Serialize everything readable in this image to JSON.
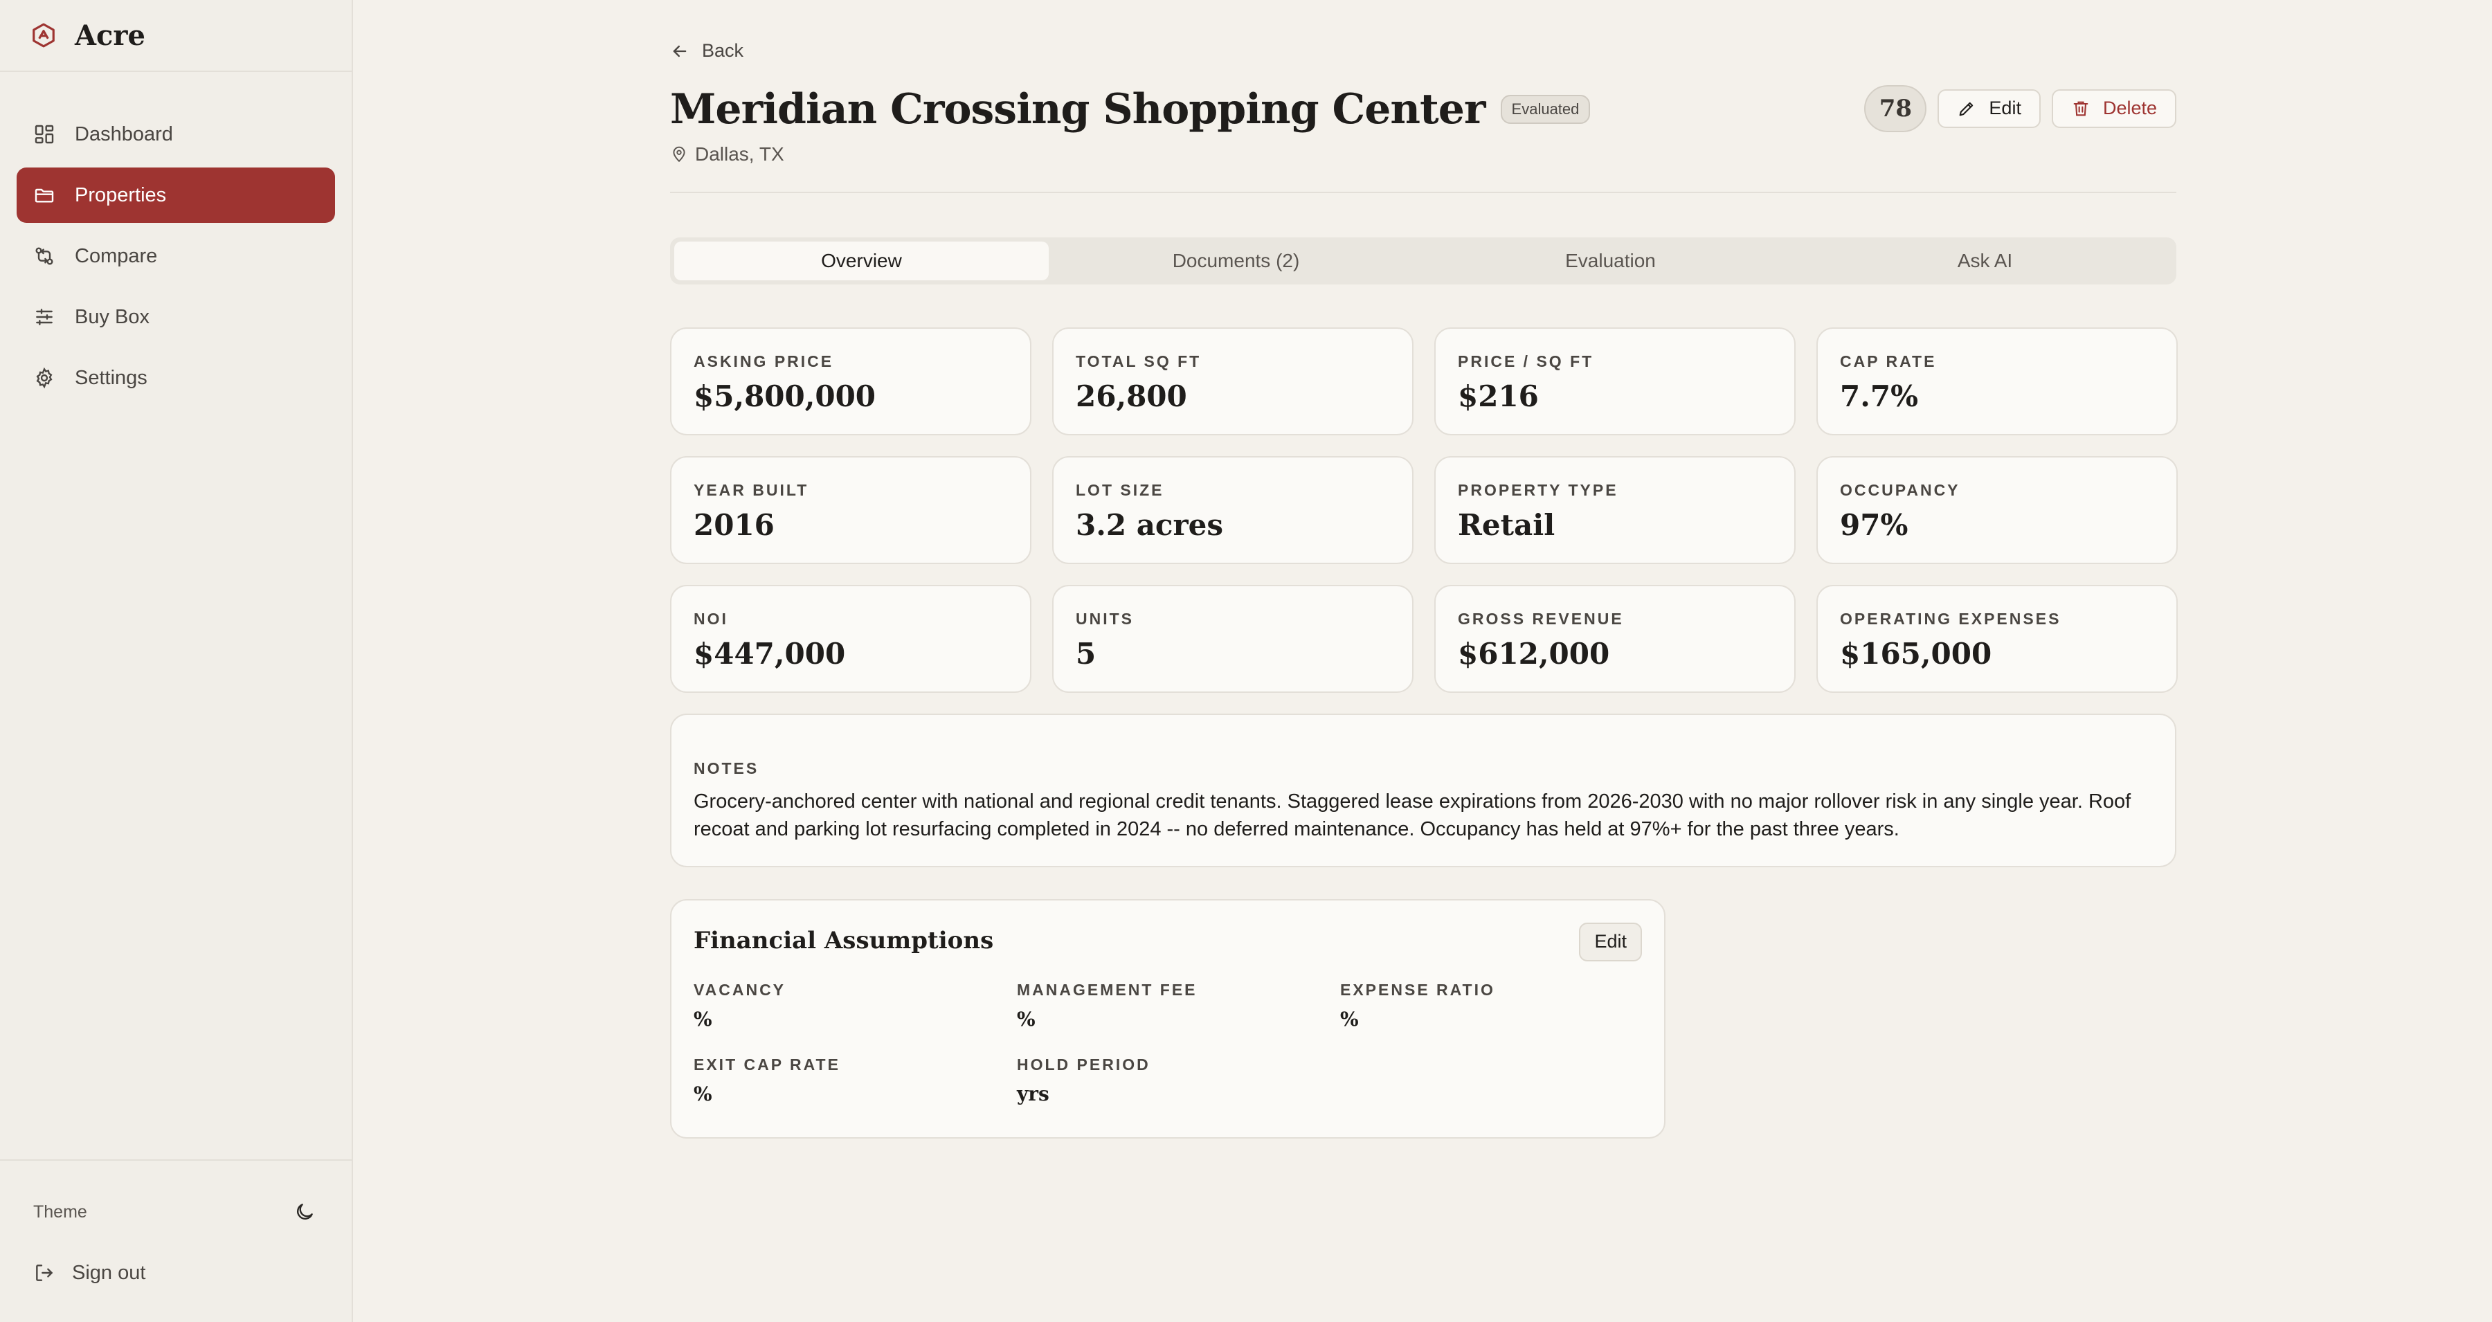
{
  "app": {
    "name": "Acre"
  },
  "sidebar": {
    "items": [
      {
        "label": "Dashboard",
        "icon": "dashboard-icon",
        "active": false
      },
      {
        "label": "Properties",
        "icon": "folder-icon",
        "active": true
      },
      {
        "label": "Compare",
        "icon": "compare-icon",
        "active": false
      },
      {
        "label": "Buy Box",
        "icon": "sliders-icon",
        "active": false
      },
      {
        "label": "Settings",
        "icon": "gear-icon",
        "active": false
      }
    ],
    "theme_label": "Theme",
    "signout_label": "Sign out"
  },
  "header": {
    "back_label": "Back",
    "title": "Meridian Crossing Shopping Center",
    "status": "Evaluated",
    "location": "Dallas, TX",
    "score": "78",
    "edit_label": "Edit",
    "delete_label": "Delete"
  },
  "tabs": [
    {
      "label": "Overview",
      "active": true
    },
    {
      "label": "Documents (2)",
      "active": false
    },
    {
      "label": "Evaluation",
      "active": false
    },
    {
      "label": "Ask AI",
      "active": false
    }
  ],
  "metrics": [
    {
      "label": "ASKING PRICE",
      "value": "$5,800,000"
    },
    {
      "label": "TOTAL SQ FT",
      "value": "26,800"
    },
    {
      "label": "PRICE / SQ FT",
      "value": "$216"
    },
    {
      "label": "CAP RATE",
      "value": "7.7%"
    },
    {
      "label": "YEAR BUILT",
      "value": "2016"
    },
    {
      "label": "LOT SIZE",
      "value": "3.2 acres"
    },
    {
      "label": "PROPERTY TYPE",
      "value": "Retail"
    },
    {
      "label": "OCCUPANCY",
      "value": "97%"
    },
    {
      "label": "NOI",
      "value": "$447,000"
    },
    {
      "label": "UNITS",
      "value": "5"
    },
    {
      "label": "GROSS REVENUE",
      "value": "$612,000"
    },
    {
      "label": "OPERATING EXPENSES",
      "value": "$165,000"
    }
  ],
  "notes": {
    "label": "NOTES",
    "text": "Grocery-anchored center with national and regional credit tenants. Staggered lease expirations from 2026-2030 with no major rollover risk in any single year. Roof recoat and parking lot resurfacing completed in 2024 -- no deferred maintenance. Occupancy has held at 97%+ for the past three years."
  },
  "financial": {
    "title": "Financial Assumptions",
    "edit_label": "Edit",
    "fields": [
      {
        "label": "VACANCY",
        "value": "%"
      },
      {
        "label": "MANAGEMENT FEE",
        "value": "%"
      },
      {
        "label": "EXPENSE RATIO",
        "value": "%"
      },
      {
        "label": "EXIT CAP RATE",
        "value": "%"
      },
      {
        "label": "HOLD PERIOD",
        "value": "yrs"
      }
    ]
  },
  "colors": {
    "accent": "#9e3431",
    "background": "#f4f1eb",
    "card": "#fbfaf7"
  }
}
